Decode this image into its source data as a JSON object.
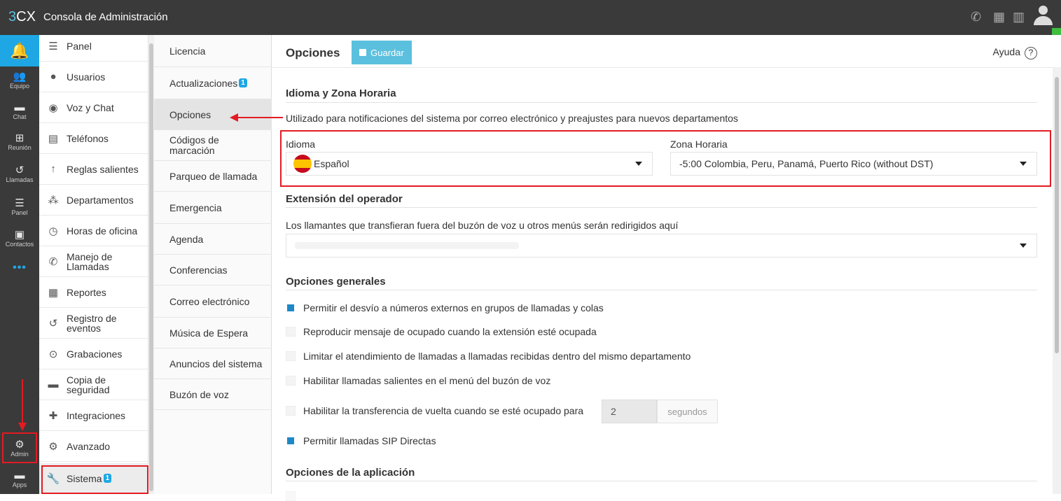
{
  "header": {
    "brand_3": "3",
    "brand_cx": "CX",
    "title": "Consola de Administración",
    "icons": [
      "phone-icon",
      "qr-icon",
      "book-icon",
      "user-icon"
    ]
  },
  "rail": {
    "items": [
      {
        "label": "Equipo",
        "icon": "team-icon"
      },
      {
        "label": "Chat",
        "icon": "chat-icon"
      },
      {
        "label": "Reunión",
        "icon": "meeting-icon"
      },
      {
        "label": "Llamadas",
        "icon": "calls-icon"
      },
      {
        "label": "Panel",
        "icon": "panel-icon"
      },
      {
        "label": "Contactos",
        "icon": "contacts-icon"
      }
    ],
    "more": "•••",
    "admin_label": "Admin",
    "apps_label": "Apps"
  },
  "menu": {
    "items": [
      {
        "label": "Panel"
      },
      {
        "label": "Usuarios"
      },
      {
        "label": "Voz y Chat"
      },
      {
        "label": "Teléfonos"
      },
      {
        "label": "Reglas salientes"
      },
      {
        "label": "Departamentos"
      },
      {
        "label": "Horas de oficina"
      },
      {
        "label": "Manejo de Llamadas"
      },
      {
        "label": "Reportes"
      },
      {
        "label": "Registro de eventos"
      },
      {
        "label": "Grabaciones"
      },
      {
        "label": "Copia de seguridad"
      },
      {
        "label": "Integraciones"
      },
      {
        "label": "Avanzado"
      },
      {
        "label": "Sistema",
        "badge": "1"
      }
    ]
  },
  "submenu": {
    "items": [
      {
        "label": "Licencia"
      },
      {
        "label": "Actualizaciones",
        "badge": "1"
      },
      {
        "label": "Opciones"
      },
      {
        "label": "Códigos de marcación"
      },
      {
        "label": "Parqueo de llamada"
      },
      {
        "label": "Emergencia"
      },
      {
        "label": "Agenda"
      },
      {
        "label": "Conferencias"
      },
      {
        "label": "Correo electrónico"
      },
      {
        "label": "Música de Espera"
      },
      {
        "label": "Anuncios del sistema"
      },
      {
        "label": "Buzón de voz"
      }
    ]
  },
  "content": {
    "title": "Opciones",
    "save_label": "Guardar",
    "help_label": "Ayuda",
    "help_icon": "?",
    "lang_section": {
      "title": "Idioma y Zona Horaria",
      "description": "Utilizado para notificaciones del sistema por correo electrónico y preajustes para nuevos departamentos",
      "language_label": "Idioma",
      "language_value": "Español",
      "timezone_label": "Zona Horaria",
      "timezone_value": "-5:00 Colombia, Peru, Panamá, Puerto Rico (without DST)"
    },
    "operator_section": {
      "title": "Extensión del operador",
      "description": "Los llamantes que transfieran fuera del buzón de voz u otros menús serán redirigidos aquí"
    },
    "general_section": {
      "title": "Opciones generales",
      "options": [
        {
          "label": "Permitir el desvío a números externos en grupos de llamadas y colas",
          "checked": true
        },
        {
          "label": "Reproducir mensaje de ocupado cuando la extensión esté ocupada",
          "checked": false
        },
        {
          "label": "Limitar el atendimiento de llamadas a llamadas recibidas dentro del mismo departamento",
          "checked": false
        },
        {
          "label": "Habilitar llamadas salientes en el menú del buzón de voz",
          "checked": false
        },
        {
          "label": "Habilitar la transferencia de vuelta cuando se esté ocupado para",
          "checked": false
        },
        {
          "label": "Permitir llamadas SIP Directas",
          "checked": true
        }
      ],
      "transfer_seconds_value": "2",
      "transfer_seconds_unit": "segundos"
    },
    "app_section": {
      "title": "Opciones de la aplicación"
    }
  },
  "colors": {
    "topbar": "#3a3a3a",
    "accent": "#1ea7e4",
    "save_button": "#5bc0de",
    "checkbox_on": "#1e88c7",
    "annotation": "#e31b23"
  }
}
